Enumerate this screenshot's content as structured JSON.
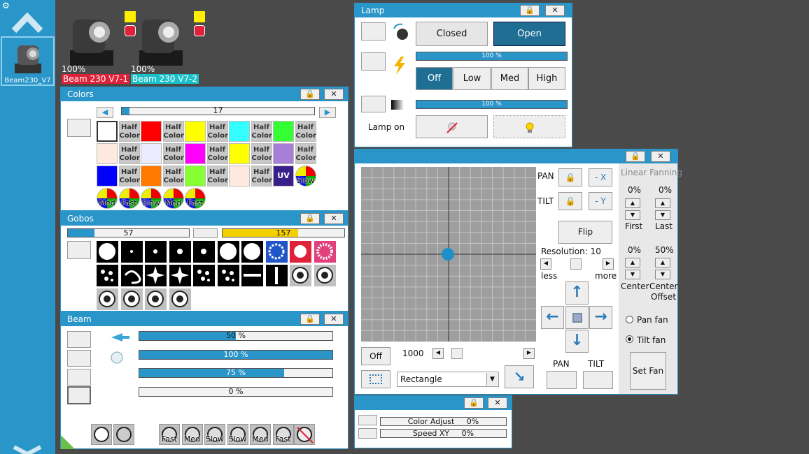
{
  "sidebar": {
    "fixture_label": "Beam230_V7"
  },
  "dock": {
    "fixtures": [
      {
        "percent": "100%",
        "name": "Beam 230 V7-1",
        "name_bg": "#e0213a"
      },
      {
        "percent": "100%",
        "name": "Beam 230 V7-2",
        "name_bg": "#1cc0c8"
      }
    ]
  },
  "colors": {
    "title": "Colors",
    "slider_value": "17",
    "slider_fraction": 0.04,
    "half_label": "Half Color",
    "wheel_labels": [
      "Slow",
      "Med",
      "Fast",
      "Slow",
      "Med",
      "Fast"
    ],
    "uv_label": "UV"
  },
  "gobos": {
    "title": "Gobos",
    "slider1_value": "57",
    "slider1_fraction": 0.22,
    "slider2_value": "157",
    "slider2_fraction": 0.62
  },
  "beam": {
    "title": "Beam",
    "bars": [
      {
        "text": "50 %",
        "fraction": 0.5
      },
      {
        "text": "100 %",
        "fraction": 1.0
      },
      {
        "text": "75 %",
        "fraction": 0.75
      },
      {
        "text": "0 %",
        "fraction": 0.0
      }
    ],
    "speed_labels": [
      "Fast",
      "Med",
      "Slow",
      "Slow",
      "Med",
      "Fast"
    ]
  },
  "lamp": {
    "title": "Lamp",
    "closed": "Closed",
    "open": "Open",
    "bar1": "100 %",
    "bar2": "100 %",
    "off": "Off",
    "low": "Low",
    "med": "Med",
    "high": "High",
    "lamp_on": "Lamp on"
  },
  "pantilt": {
    "pan": "PAN",
    "tilt": "TILT",
    "minus_x": "- X",
    "minus_y": "- Y",
    "flip": "Flip",
    "resolution": "Resolution: 10",
    "less": "less",
    "more": "more",
    "off": "Off",
    "value": "1000",
    "shape": "Rectangle",
    "pan_bottom": "PAN",
    "tilt_bottom": "TILT",
    "fanning_title": "Linear Fanning",
    "first_pct": "0%",
    "last_pct": "0%",
    "first": "First",
    "last": "Last",
    "center_pct": "0%",
    "offset_pct": "50%",
    "center": "Center",
    "center_offset": "Center Offset",
    "pan_fan": "Pan fan",
    "tilt_fan": "Tilt fan",
    "set_fan": "Set Fan"
  },
  "small": {
    "color_adjust": "Color Adjust     0%",
    "speed_xy": "Speed XY     0%"
  },
  "colors_theme": {
    "accent": "#2a95c8",
    "panel_bg": "#ffffff",
    "desktop": "#4a4a4a"
  }
}
